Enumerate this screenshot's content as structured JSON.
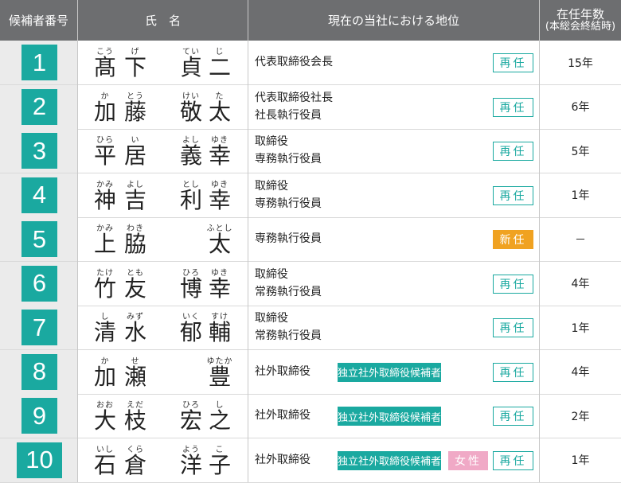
{
  "headers": {
    "number": "候補者番号",
    "name": "氏　名",
    "position": "現在の当社における地位",
    "term_line1": "在任年数",
    "term_line2": "(本総会終結時)"
  },
  "candidates": [
    {
      "no": "1",
      "name": [
        {
          "r": "こう",
          "k": "髙"
        },
        {
          "r": "げ",
          "k": "下"
        },
        {
          "r": "てい",
          "k": "貞"
        },
        {
          "r": "じ",
          "k": "二"
        }
      ],
      "pos": [
        "代表取締役会長"
      ],
      "status": "再任",
      "tags": [],
      "term": "15年"
    },
    {
      "no": "2",
      "name": [
        {
          "r": "か",
          "k": "加"
        },
        {
          "r": "とう",
          "k": "藤"
        },
        {
          "r": "けい",
          "k": "敬"
        },
        {
          "r": "た",
          "k": "太"
        }
      ],
      "pos": [
        "代表取締役社長",
        "社長執行役員"
      ],
      "status": "再任",
      "tags": [],
      "term": "6年"
    },
    {
      "no": "3",
      "name": [
        {
          "r": "ひら",
          "k": "平"
        },
        {
          "r": "い",
          "k": "居"
        },
        {
          "r": "よし",
          "k": "義"
        },
        {
          "r": "ゆき",
          "k": "幸"
        }
      ],
      "pos": [
        "取締役",
        "専務執行役員"
      ],
      "status": "再任",
      "tags": [],
      "term": "5年"
    },
    {
      "no": "4",
      "name": [
        {
          "r": "かみ",
          "k": "神"
        },
        {
          "r": "よし",
          "k": "吉"
        },
        {
          "r": "とし",
          "k": "利"
        },
        {
          "r": "ゆき",
          "k": "幸"
        }
      ],
      "pos": [
        "取締役",
        "専務執行役員"
      ],
      "status": "再任",
      "tags": [],
      "term": "1年"
    },
    {
      "no": "5",
      "name": [
        {
          "r": "かみ",
          "k": "上"
        },
        {
          "r": "わき",
          "k": "脇"
        },
        {
          "r": "",
          "k": ""
        },
        {
          "r": "ふとし",
          "k": "太"
        }
      ],
      "pos": [
        "専務執行役員"
      ],
      "status": "新任",
      "tags": [],
      "term": "－"
    },
    {
      "no": "6",
      "name": [
        {
          "r": "たけ",
          "k": "竹"
        },
        {
          "r": "とも",
          "k": "友"
        },
        {
          "r": "ひろ",
          "k": "博"
        },
        {
          "r": "ゆき",
          "k": "幸"
        }
      ],
      "pos": [
        "取締役",
        "常務執行役員"
      ],
      "status": "再任",
      "tags": [],
      "term": "4年"
    },
    {
      "no": "7",
      "name": [
        {
          "r": "し",
          "k": "清"
        },
        {
          "r": "みず",
          "k": "水"
        },
        {
          "r": "いく",
          "k": "郁"
        },
        {
          "r": "すけ",
          "k": "輔"
        }
      ],
      "pos": [
        "取締役",
        "常務執行役員"
      ],
      "status": "再任",
      "tags": [],
      "term": "1年"
    },
    {
      "no": "8",
      "name": [
        {
          "r": "か",
          "k": "加"
        },
        {
          "r": "せ",
          "k": "瀬"
        },
        {
          "r": "",
          "k": ""
        },
        {
          "r": "ゆたか",
          "k": "豊"
        }
      ],
      "pos": [
        "社外取締役"
      ],
      "status": "再任",
      "tags": [
        "独立社外取締役候補者"
      ],
      "term": "4年"
    },
    {
      "no": "9",
      "name": [
        {
          "r": "おお",
          "k": "大"
        },
        {
          "r": "えだ",
          "k": "枝"
        },
        {
          "r": "ひろ",
          "k": "宏"
        },
        {
          "r": "し",
          "k": "之"
        }
      ],
      "pos": [
        "社外取締役"
      ],
      "status": "再任",
      "tags": [
        "独立社外取締役候補者"
      ],
      "term": "2年"
    },
    {
      "no": "10",
      "name": [
        {
          "r": "いし",
          "k": "石"
        },
        {
          "r": "くら",
          "k": "倉"
        },
        {
          "r": "よう",
          "k": "洋"
        },
        {
          "r": "こ",
          "k": "子"
        }
      ],
      "pos": [
        "社外取締役"
      ],
      "status": "再任",
      "tags": [
        "独立社外取締役候補者",
        "女性"
      ],
      "term": "1年"
    }
  ],
  "colors": {
    "header_bg": "#6d6e70",
    "teal": "#1aa9a0",
    "orange": "#f0a221",
    "pink": "#f0a9c6",
    "number_col_bg": "#ebebeb"
  }
}
